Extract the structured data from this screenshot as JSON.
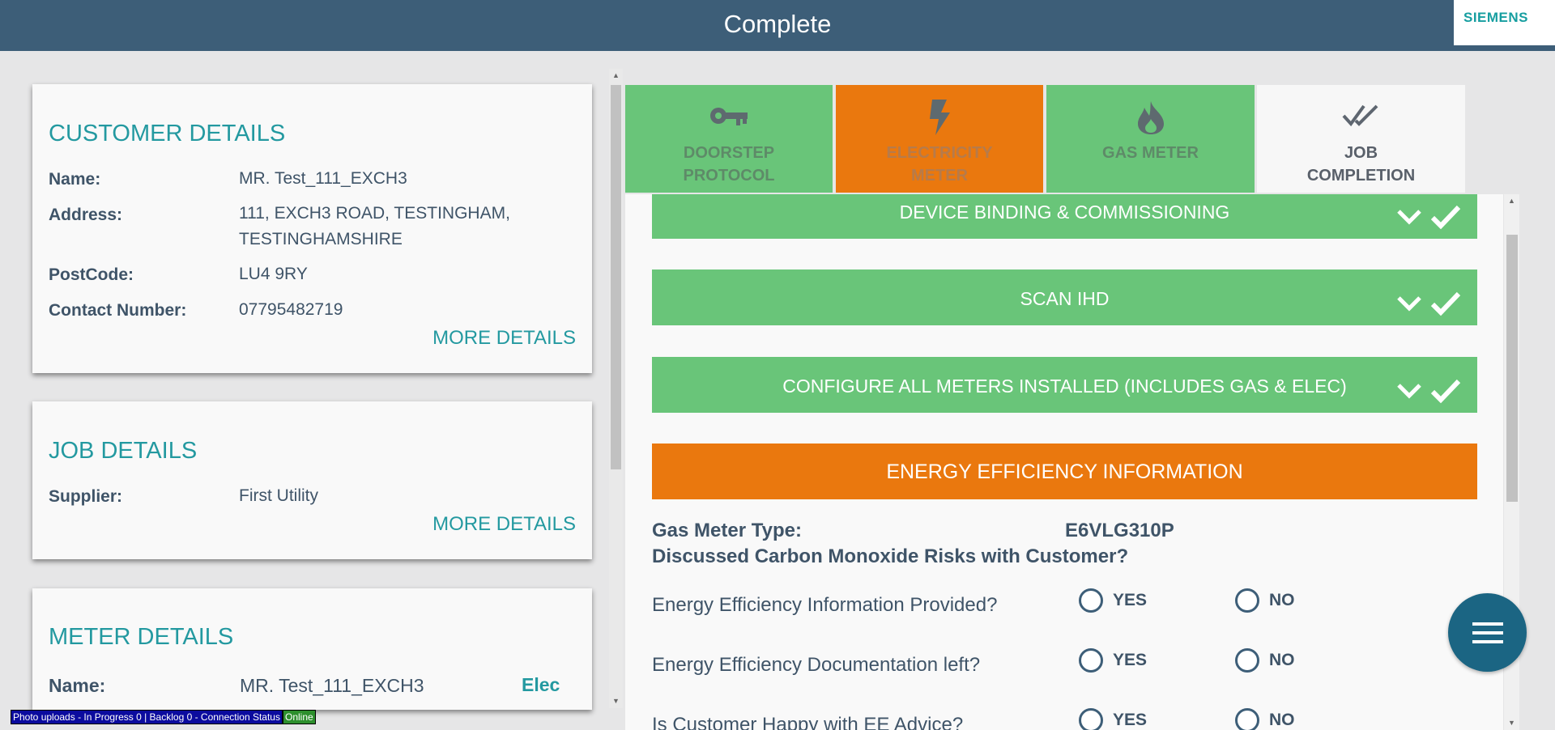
{
  "header": {
    "title": "Complete",
    "logo": "SIEMENS"
  },
  "customer": {
    "title": "CUSTOMER DETAILS",
    "name_label": "Name:",
    "name": "MR. Test_111_EXCH3",
    "address_label": "Address:",
    "address_line1": "111, EXCH3 ROAD, TESTINGHAM,",
    "address_line2": "TESTINGHAMSHIRE",
    "postcode_label": "PostCode:",
    "postcode": "LU4 9RY",
    "contact_label": "Contact Number:",
    "contact": "07795482719",
    "more": "MORE DETAILS"
  },
  "job": {
    "title": "JOB DETAILS",
    "supplier_label": "Supplier:",
    "supplier": "First Utility",
    "more": "MORE DETAILS"
  },
  "meter": {
    "title": "METER DETAILS",
    "name_label": "Name:",
    "name": "MR. Test_111_EXCH3",
    "tag": "Elec"
  },
  "tabs": [
    {
      "line1": "DOORSTEP",
      "line2": "PROTOCOL",
      "icon": "key-icon",
      "color": "#69c579"
    },
    {
      "line1": "ELECTRICITY",
      "line2": "METER",
      "icon": "lightning-icon",
      "color": "#ea780e"
    },
    {
      "line1": "GAS METER",
      "line2": "",
      "icon": "flame-icon",
      "color": "#69c579"
    },
    {
      "line1": "JOB",
      "line2": "COMPLETION",
      "icon": "double-check-icon",
      "color": "#f7f7f7"
    }
  ],
  "sections": [
    {
      "label": "DEVICE BINDING & COMMISSIONING"
    },
    {
      "label": "SCAN IHD"
    },
    {
      "label": "CONFIGURE ALL METERS INSTALLED (INCLUDES GAS & ELEC)"
    },
    {
      "label": "ENERGY EFFICIENCY INFORMATION"
    }
  ],
  "info": {
    "gas_meter_type_label": "Gas Meter Type:",
    "gas_meter_type": "E6VLG310P",
    "co_question": "Discussed Carbon Monoxide Risks with Customer?"
  },
  "questions": [
    {
      "text": "Energy Efficiency Information Provided?",
      "yes": "YES",
      "no": "NO"
    },
    {
      "text": "Energy Efficiency Documentation left?",
      "yes": "YES",
      "no": "NO"
    },
    {
      "text": "Is Customer Happy with EE Advice?",
      "yes": "YES",
      "no": "NO"
    }
  ],
  "status": {
    "text": "Photo uploads - In Progress 0 | Backlog 0 - Connection Status",
    "connection": "Online"
  }
}
